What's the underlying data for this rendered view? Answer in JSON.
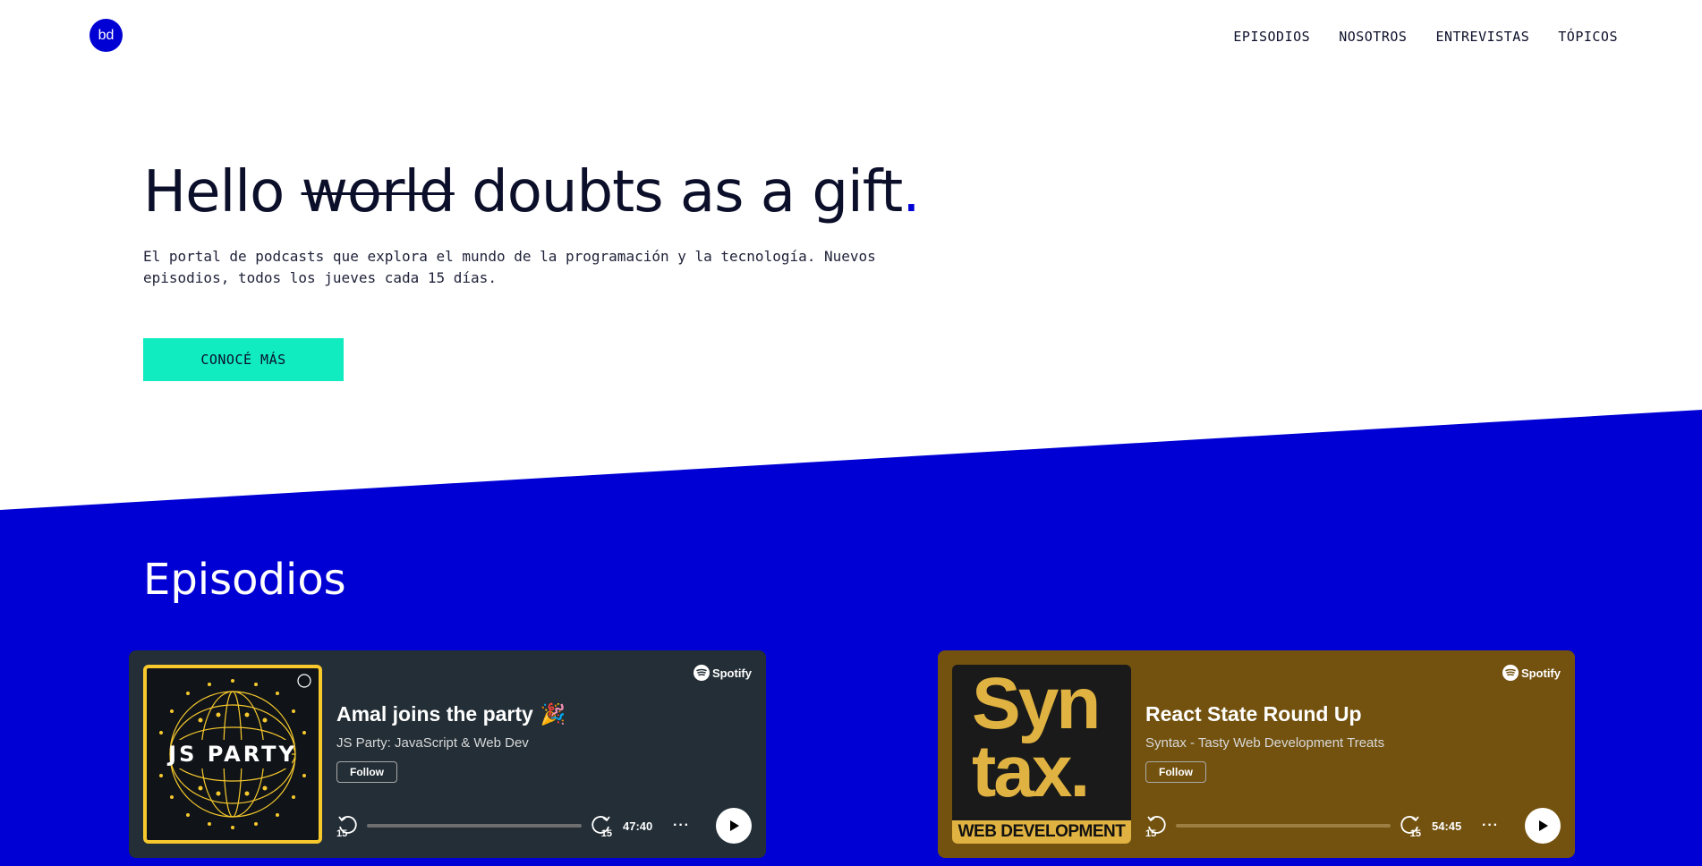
{
  "header": {
    "logo_text": "bd",
    "nav": [
      "EPISODIOS",
      "NOSOTROS",
      "ENTREVISTAS",
      "TÓPICOS"
    ]
  },
  "hero": {
    "title_prefix": "Hello ",
    "title_strike": "world",
    "title_suffix": " doubts as a gift",
    "title_dot": ".",
    "description": "El portal de podcasts que explora el mundo de la programación y la tecnología. Nuevos episodios, todos los jueves cada 15 días.",
    "cta_label": "CONOCÉ MÁS"
  },
  "episodes": {
    "section_title": "Episodios",
    "cards": [
      {
        "art_text": "JS PARTY",
        "brand": "Spotify",
        "title": "Amal joins the party",
        "title_emoji": "🎉",
        "show": "JS Party: JavaScript & Web Dev",
        "follow_label": "Follow",
        "skip_back_label": "15",
        "skip_fwd_label": "15",
        "duration": "47:40",
        "more": "···"
      },
      {
        "art_text_line1": "Syn",
        "art_text_line2": "tax.",
        "art_banner": "WEB DEVELOPMENT",
        "brand": "Spotify",
        "title": "React State Round Up",
        "show": "Syntax - Tasty Web Development Treats",
        "follow_label": "Follow",
        "skip_back_label": "15",
        "skip_fwd_label": "15",
        "duration": "54:45",
        "more": "···"
      }
    ]
  },
  "colors": {
    "brand_blue": "#0000d4",
    "cta_teal": "#10ebc0",
    "jsparty_card": "#232e36",
    "syntax_card": "#73520f"
  }
}
